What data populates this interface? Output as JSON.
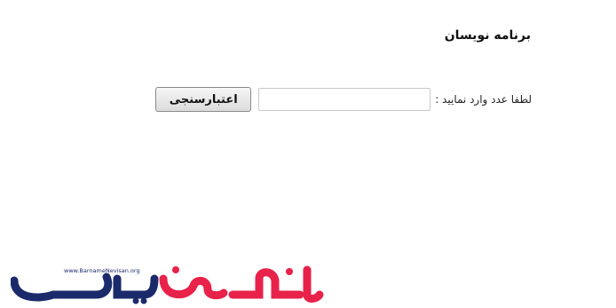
{
  "page": {
    "title": "برنامه نویسان"
  },
  "form": {
    "prompt_label": "لطفا عدد وارد نمایید :",
    "input_value": "",
    "validate_button_label": "اعتبارسنجی"
  },
  "logo": {
    "url_text": "www.BarnameNevisan.org",
    "brand_text": "برنامه نویسان",
    "colors": {
      "navy": "#1b2a6b",
      "red": "#e8224a"
    }
  }
}
